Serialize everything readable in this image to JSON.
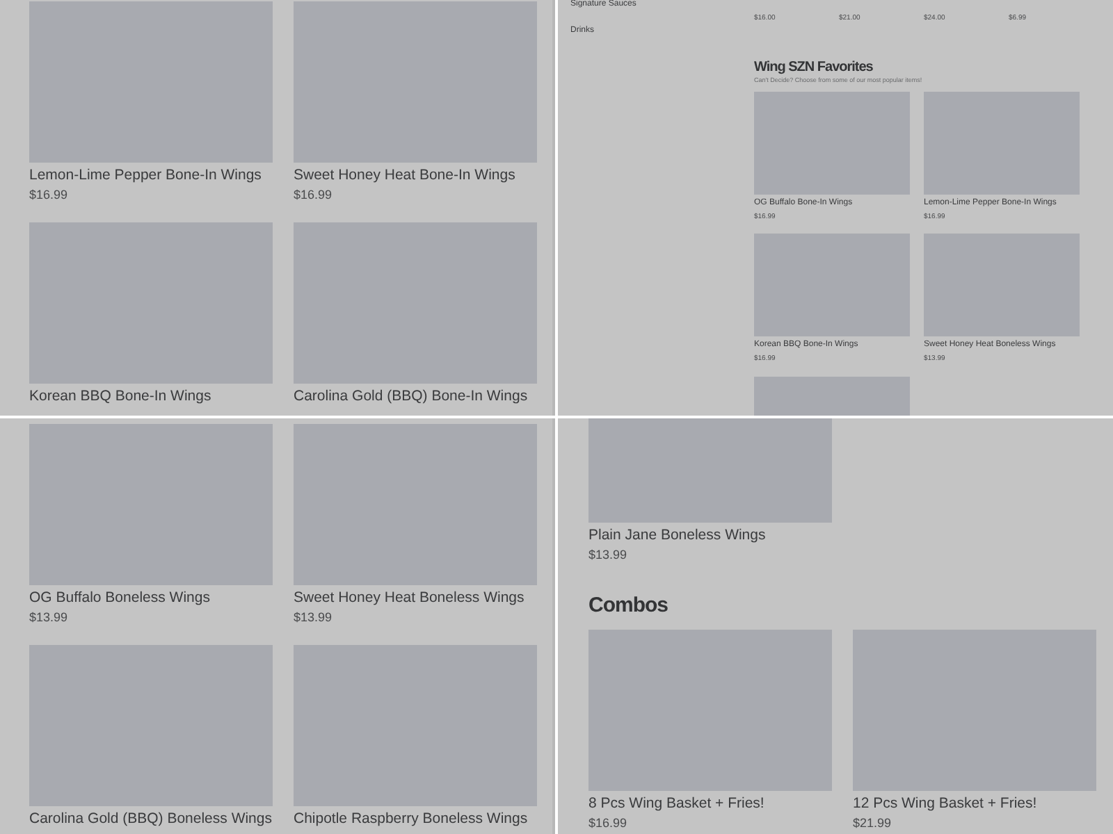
{
  "panels": [
    {
      "kind": "grid",
      "cards": [
        {
          "name": "Lemon-Lime Pepper Bone-In Wings",
          "price": "$16.99"
        },
        {
          "name": "Sweet Honey Heat Bone-In Wings",
          "price": "$16.99"
        },
        {
          "name": "Korean BBQ Bone-In Wings"
        },
        {
          "name": "Carolina Gold (BBQ) Bone-In Wings"
        }
      ]
    },
    {
      "kind": "menu",
      "sidebar": [
        "Signature Sauces",
        "Drinks"
      ],
      "prices": [
        "$16.00",
        "$21.00",
        "$24.00",
        "$6.99"
      ],
      "section": {
        "title": "Wing SZN Favorites",
        "subtitle": "Can't Decide? Choose from some of our most popular items!",
        "cards": [
          {
            "kind": "item",
            "name": "OG Buffalo Bone-In Wings",
            "price": "$16.99"
          },
          {
            "kind": "item",
            "name": "Lemon-Lime Pepper Bone-In Wings",
            "price": "$16.99"
          },
          {
            "kind": "item",
            "name": "Korean BBQ Bone-In Wings",
            "price": "$16.99"
          },
          {
            "kind": "item",
            "name": "Sweet Honey Heat Boneless Wings",
            "price": "$13.99"
          },
          {
            "kind": "picture"
          }
        ]
      }
    },
    {
      "kind": "grid",
      "cards": [
        {
          "name": "OG Buffalo Boneless Wings",
          "price": "$13.99"
        },
        {
          "name": "Sweet Honey Heat Boneless Wings",
          "price": "$13.99"
        },
        {
          "name": "Carolina Gold (BBQ) Boneless Wings"
        },
        {
          "name": "Chipotle Raspberry Boneless Wings"
        }
      ]
    },
    {
      "kind": "combo",
      "cards": [
        {
          "name": "Plain Jane Boneless Wings",
          "price": "$13.99"
        }
      ],
      "section": {
        "title": "Combos",
        "cards": [
          {
            "name": "8 Pcs Wing Basket + Fries!",
            "price": "$16.99"
          },
          {
            "name": "12 Pcs Wing Basket + Fries!",
            "price": "$21.99"
          }
        ]
      }
    }
  ]
}
